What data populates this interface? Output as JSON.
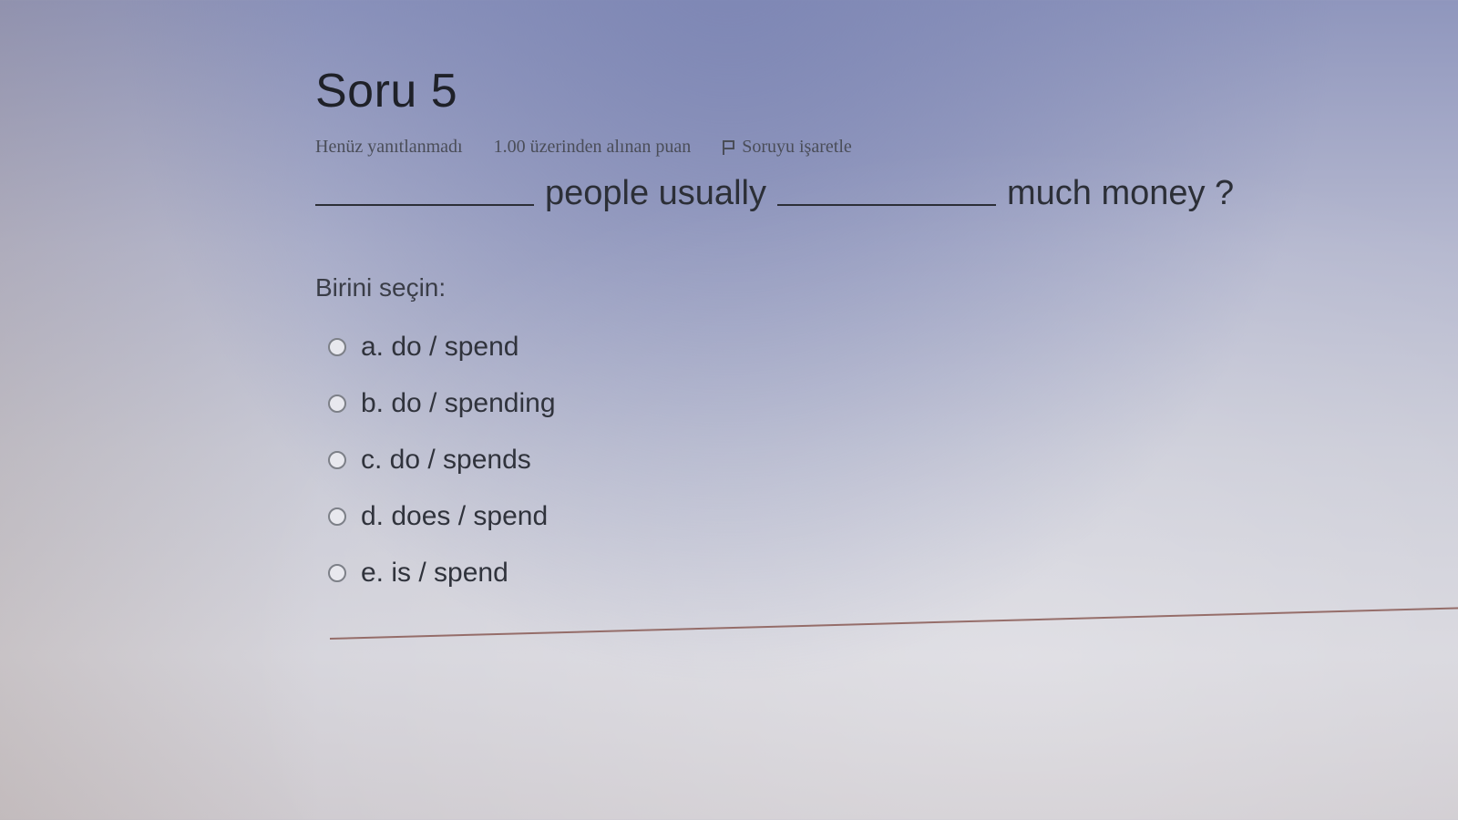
{
  "question": {
    "title": "Soru 5",
    "status": "Henüz yanıtlanmadı",
    "points": "1.00 üzerinden alınan puan",
    "flag_label": "Soruyu işaretle",
    "flag_icon": "flag-icon",
    "stem_part_1": "people usually",
    "stem_part_2": "much money ?",
    "prompt": "Birini seçin:",
    "options": [
      {
        "label": "a. do / spend",
        "selected": false
      },
      {
        "label": "b. do / spending",
        "selected": false
      },
      {
        "label": "c. do / spends",
        "selected": false
      },
      {
        "label": "d. does / spend",
        "selected": false
      },
      {
        "label": "e. is / spend",
        "selected": false
      }
    ]
  }
}
